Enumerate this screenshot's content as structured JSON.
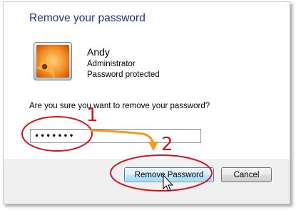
{
  "dialog": {
    "title": "Remove your password"
  },
  "user": {
    "name": "Andy",
    "role": "Administrator",
    "status": "Password protected"
  },
  "prompt": {
    "question": "Are you sure you want to remove your password?",
    "password_value": "•••••••"
  },
  "buttons": {
    "remove_label": "Remove Password",
    "cancel_label": "Cancel"
  },
  "annotations": {
    "step1": "1",
    "step2": "2"
  },
  "colors": {
    "title": "#1e3287",
    "annotation_red": "#d4141c",
    "annotation_arrow": "#f29b1a",
    "footer": "#f0f0f0",
    "primary_button_border": "#3c7fb1"
  },
  "icons": {
    "avatar": "orange-flower-avatar-icon",
    "cursor": "mouse-pointer-icon",
    "arrow": "curved-arrow-icon"
  }
}
